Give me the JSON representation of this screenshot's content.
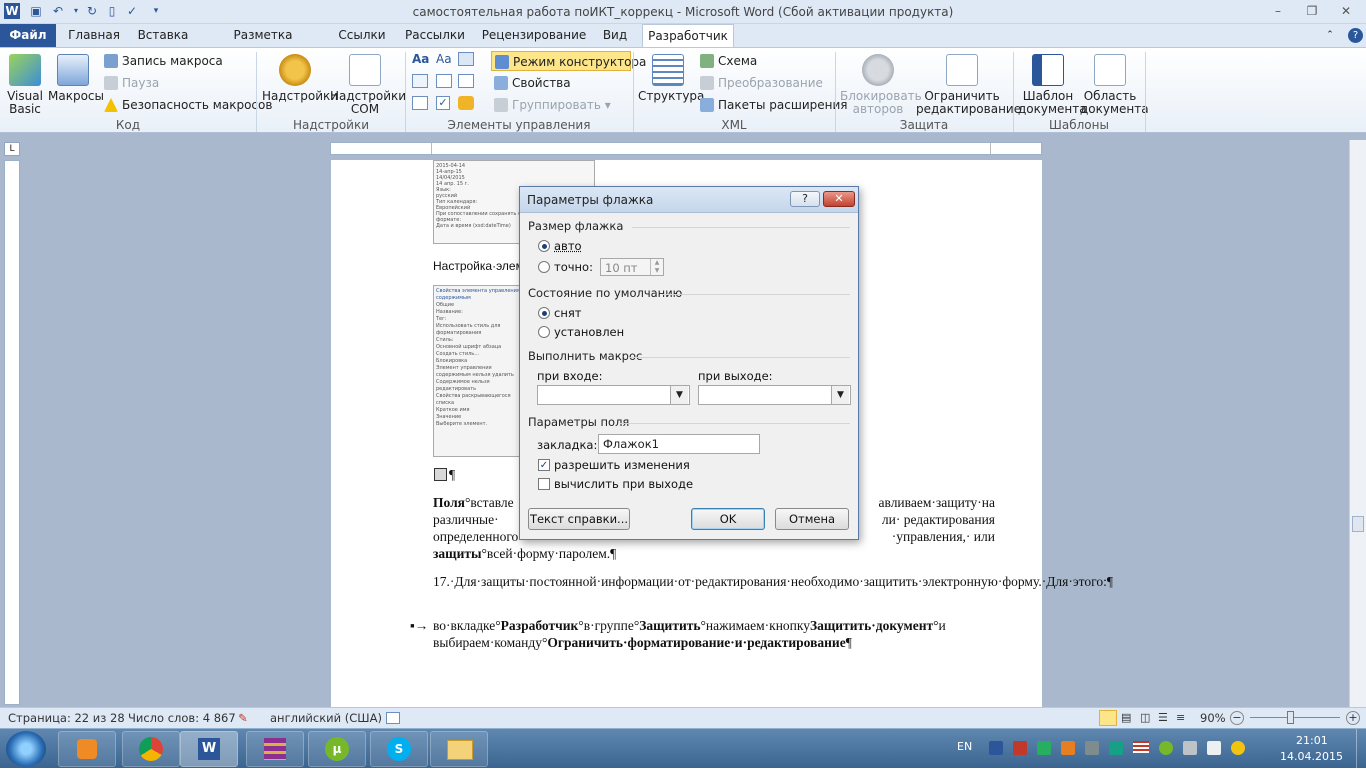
{
  "window": {
    "title": "самостоятельная работа поИКТ_коррекц  -  Microsoft Word (Сбой активации продукта)",
    "help_glyph": "?"
  },
  "tabs": [
    "Файл",
    "Главная",
    "Вставка",
    "Разметка страницы",
    "Ссылки",
    "Рассылки",
    "Рецензирование",
    "Вид",
    "Разработчик"
  ],
  "ribbon": {
    "code": {
      "label": "Код",
      "visual_basic": "Visual\nBasic",
      "macros": "Макросы",
      "record_macro": "Запись макроса",
      "pause": "Пауза",
      "macro_security": "Безопасность макросов"
    },
    "addins": {
      "label": "Надстройки",
      "addins": "Надстройки",
      "com_addins": "Надстройки\nCOM"
    },
    "controls": {
      "label": "Элементы управления",
      "design_mode": "Режим конструктора",
      "properties": "Свойства",
      "group": "Группировать"
    },
    "xml": {
      "label": "XML",
      "structure": "Структура",
      "schema": "Схема",
      "transform": "Преобразование",
      "expansion_packs": "Пакеты расширения"
    },
    "protect": {
      "label": "Защита",
      "block_authors": "Блокировать\nавторов",
      "restrict_editing": "Ограничить\nредактирование"
    },
    "templates": {
      "label": "Шаблоны",
      "document_template": "Шаблон\nдокумента",
      "document_panel": "Область\nдокумента"
    }
  },
  "document": {
    "thumb1_lines": [
      "2015-04-14",
      "14-апр-15",
      "14/04/2015",
      "14 апр. 15 г.",
      "Язык:",
      "русский",
      "Тип календаря:",
      "Европейский",
      "При сопоставлении сохранять содержимое в следующем формате:",
      "Дата и время (xsd:dateTime)"
    ],
    "caption_fragment": "Настройка·элем",
    "thumb2_lines": [
      "Свойства элемента управления содержимым",
      "Общие",
      "Название:",
      "Тег:",
      "Использовать стиль для форматирования",
      "Стиль:",
      "Основной шрифт абзаца",
      "Создать стиль...",
      "Блокировка",
      "Элемент управления содержимым нельзя удалить",
      "Содержимое нельзя редактировать",
      "Свойства раскрывающегося списка",
      "Краткое имя",
      "Значение",
      "Выберите элемент."
    ],
    "checkbox_pilcrow": "¶",
    "para1_lines": [
      {
        "bold": "Поля",
        "text": "°вставле",
        "right": "авливаем·защиту·на"
      },
      {
        "text": "различные·",
        "right": "ли·   редактирования"
      },
      {
        "text": "определенного",
        "right": "·управления,·   или"
      },
      {
        "bold": "защиты",
        "text": "°всей·форму·паролем.¶"
      }
    ],
    "para2": "17.·Для·защиты·постоянной·информации·от·редактирования·необходимо·защитить·электронную·форму.·Для·этого:¶",
    "para3": {
      "bullet": "▪→",
      "t1": "во·вкладке°",
      "b1": "Разработчик",
      "t2": "°в·группе°",
      "b2": "Защитить",
      "t3": "°нажимаем·кнопку",
      "b3": "Защитить·документ",
      "t4": "°и",
      "t5": "выбираем·команду°",
      "b4": "Ограничить·форматирование·и·редактирование",
      "t6": "¶"
    }
  },
  "dialog": {
    "title": "Параметры флажка",
    "size_section": "Размер флажка",
    "auto": "авто",
    "exact": "точно:",
    "exact_value": "10 пт",
    "default_section": "Состояние по умолчанию",
    "unchecked": "снят",
    "checked": "установлен",
    "macro_section": "Выполнить макрос",
    "on_entry": "при входе:",
    "on_exit": "при выходе:",
    "field_section": "Параметры поля",
    "bookmark": "закладка:",
    "bookmark_value": "Флажок1",
    "allow_changes": "разрешить изменения",
    "calc_on_exit": "вычислить при выходе",
    "help_text": "Текст справки...",
    "ok": "OK",
    "cancel": "Отмена"
  },
  "status": {
    "page": "Страница: 22 из 28",
    "words": "Число слов: 4 867",
    "language": "английский (США)",
    "zoom": "90%"
  },
  "taskbar": {
    "lang": "EN",
    "time": "21:01",
    "date": "14.04.2015"
  },
  "colors": {
    "accent": "#2b579a",
    "design_mode_highlight": "#fde58a"
  }
}
